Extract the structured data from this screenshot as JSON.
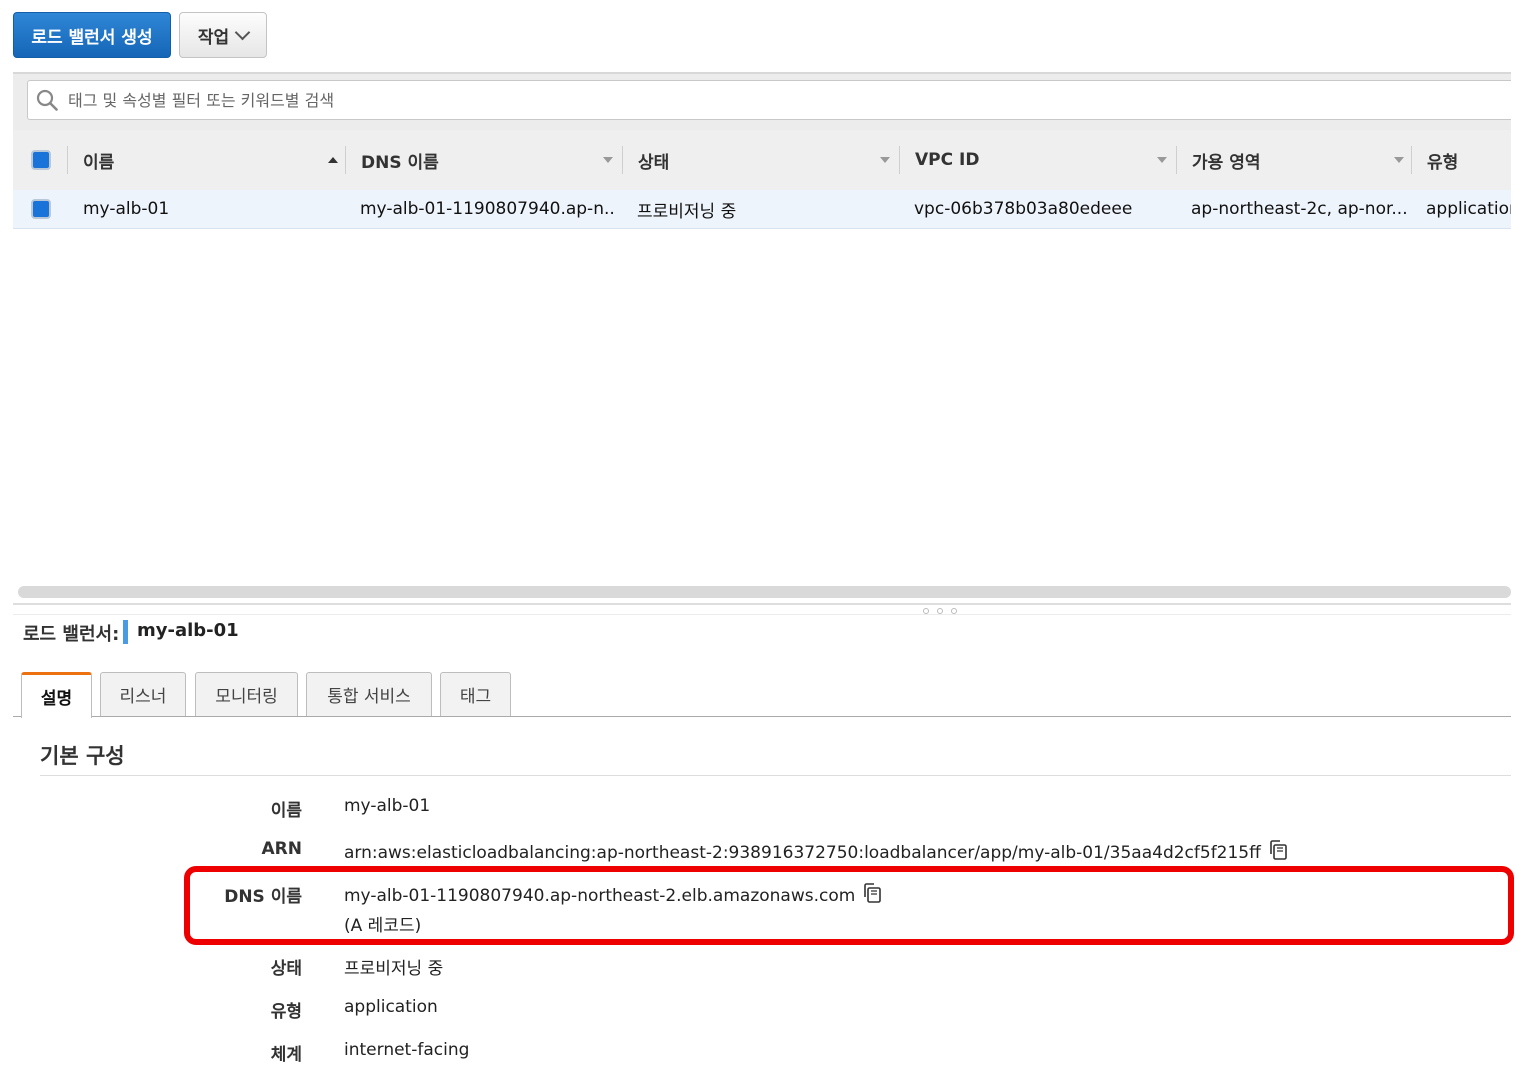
{
  "toolbar": {
    "create_label": "로드 밸런서 생성",
    "actions_label": "작업"
  },
  "search": {
    "placeholder": "태그 및 속성별 필터 또는 키워드별 검색"
  },
  "table": {
    "columns": [
      "이름",
      "DNS 이름",
      "상태",
      "VPC ID",
      "가용 영역",
      "유형"
    ],
    "rows": [
      {
        "name": "my-alb-01",
        "dns": "my-alb-01-1190807940.ap-n...",
        "state": "프로비저닝 중",
        "vpc": "vpc-06b378b03a80edeee",
        "az": "ap-northeast-2c, ap-nor...",
        "type": "application"
      }
    ]
  },
  "detail": {
    "header_label": "로드 밸런서:",
    "header_name": "my-alb-01",
    "tabs": [
      "설명",
      "리스너",
      "모니터링",
      "통합 서비스",
      "태그"
    ],
    "section_title": "기본 구성",
    "fields": {
      "name_label": "이름",
      "name_value": "my-alb-01",
      "arn_label": "ARN",
      "arn_value": "arn:aws:elasticloadbalancing:ap-northeast-2:938916372750:loadbalancer/app/my-alb-01/35aa4d2cf5f215ff",
      "dns_label": "DNS 이름",
      "dns_value": "my-alb-01-1190807940.ap-northeast-2.elb.amazonaws.com",
      "dns_record": "(A 레코드)",
      "state_label": "상태",
      "state_value": "프로비저닝 중",
      "type_label": "유형",
      "type_value": "application",
      "scheme_label": "체계",
      "scheme_value": "internet-facing"
    }
  },
  "colors": {
    "primary": "#1a6fc9",
    "accent_tab": "#ec7211",
    "highlight": "#ee0000",
    "selected_row": "#eef4fc"
  }
}
